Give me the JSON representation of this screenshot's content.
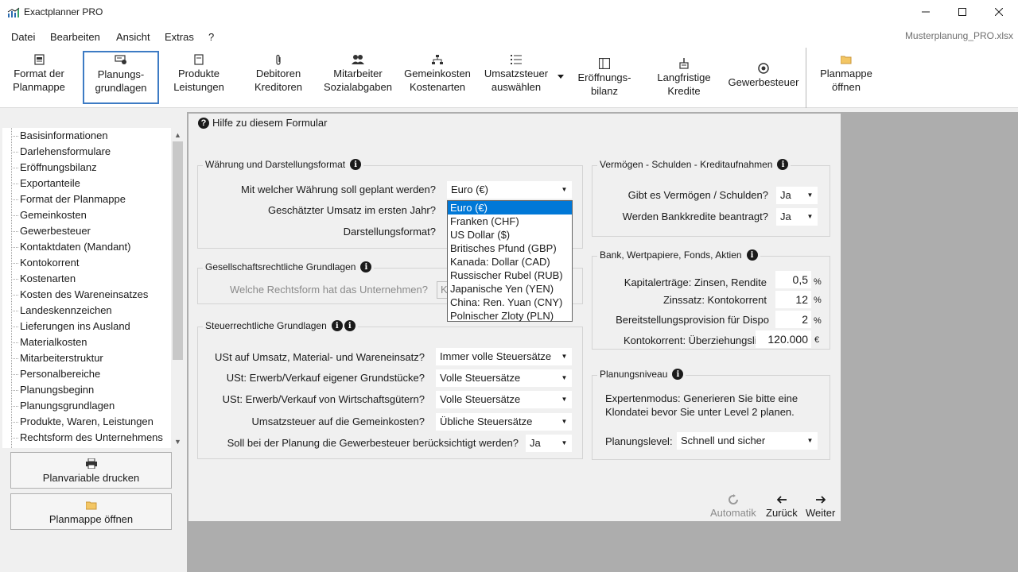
{
  "window": {
    "title": "Exactplanner PRO",
    "filename": "Musterplanung_PRO.xlsx"
  },
  "menu": [
    {
      "label": "Datei"
    },
    {
      "label": "Bearbeiten"
    },
    {
      "label": "Ansicht"
    },
    {
      "label": "Extras"
    },
    {
      "label": "?"
    }
  ],
  "ribbon": {
    "format": {
      "line1": "Format der",
      "line2": "Planmappe",
      "icon": "document-format-icon"
    },
    "planung": {
      "line1": "Planungs-",
      "line2": "grundlagen",
      "icon": "settings-icon"
    },
    "produkte": {
      "line1": "Produkte",
      "line2": "Leistungen",
      "icon": "document-icon"
    },
    "debitoren": {
      "line1": "Debitoren",
      "line2": "Kreditoren",
      "icon": "paperclip-icon"
    },
    "mitarbeiter": {
      "line1": "Mitarbeiter",
      "line2": "Sozialabgaben",
      "icon": "people-icon"
    },
    "gemeinkosten": {
      "line1": "Gemeinkosten",
      "line2": "Kostenarten",
      "icon": "hierarchy-icon"
    },
    "umsatzsteuer": {
      "line1": "Umsatzsteuer",
      "line2": "auswählen",
      "icon": "list-icon"
    },
    "eroeffnung": {
      "line1": "Eröffnungs-",
      "line2": "bilanz",
      "icon": "balance-sheet-icon"
    },
    "kredite": {
      "line1": "Langfristige",
      "line2": "Kredite",
      "icon": "bank-icon"
    },
    "gewerbesteuer": {
      "line1": "Gewerbesteuer",
      "line2": "",
      "icon": "tax-icon"
    },
    "planmappe": {
      "line1": "Planmappe",
      "line2": "öffnen",
      "icon": "folder-icon"
    }
  },
  "tree": {
    "items": [
      "Basisinformationen",
      "Darlehensformulare",
      "Eröffnungsbilanz",
      "Exportanteile",
      "Format der Planmappe",
      "Gemeinkosten",
      "Gewerbesteuer",
      "Kontaktdaten (Mandant)",
      "Kontokorrent",
      "Kostenarten",
      "Kosten des Wareneinsatzes",
      "Landeskennzeichen",
      "Lieferungen ins Ausland",
      "Materialkosten",
      "Mitarbeiterstruktur",
      "Personalbereiche",
      "Planungsbeginn",
      "Planungsgrundlagen",
      "Produkte, Waren, Leistungen",
      "Rechtsform des Unternehmens"
    ]
  },
  "side_buttons": {
    "print": "Planvariable drucken",
    "open": "Planmappe öffnen"
  },
  "form": {
    "help": "Hilfe zu diesem Formular",
    "waehrung": {
      "title": "Währung und Darstellungsformat",
      "q_currency": "Mit welcher Währung soll geplant werden?",
      "currency_value": "Euro (€)",
      "q_umsatz": "Geschätzter Umsatz im ersten Jahr?",
      "q_format": "Darstellungsformat?"
    },
    "gesellschaft": {
      "title": "Gesellschaftsrechtliche Grundlagen",
      "q_rechtsform": "Welche Rechtsform hat das Unternehmen?",
      "rechtsform_value": "K"
    },
    "steuer": {
      "title": "Steuerrechtliche Grundlagen",
      "rows": [
        {
          "label": "USt auf Umsatz, Material- und Wareneinsatz?",
          "value": "Immer volle Steuersätze"
        },
        {
          "label": "USt: Erwerb/Verkauf eigener Grundstücke?",
          "value": "Volle Steuersätze"
        },
        {
          "label": "USt: Erwerb/Verkauf von Wirtschaftsgütern?",
          "value": "Volle Steuersätze"
        },
        {
          "label": "Umsatzsteuer auf die Gemeinkosten?",
          "value": "Übliche Steuersätze"
        }
      ],
      "q_gewerbe": "Soll bei der Planung die Gewerbesteuer berücksichtigt werden?",
      "gewerbe_value": "Ja"
    },
    "vermoegen": {
      "title": "Vermögen - Schulden - Kreditaufnahmen",
      "q_vermoegen": "Gibt es Vermögen / Schulden?",
      "vermoegen_value": "Ja",
      "q_kredite": "Werden Bankkredite beantragt?",
      "kredite_value": "Ja"
    },
    "bank": {
      "title": "Bank, Wertpapiere, Fonds, Aktien",
      "rows": [
        {
          "label": "Kapitalerträge: Zinsen, Rendite",
          "value": "0,5",
          "unit": "%"
        },
        {
          "label": "Zinssatz: Kontokorrent",
          "value": "12",
          "unit": "%"
        },
        {
          "label": "Bereitstellungsprovision für Dispo",
          "value": "2",
          "unit": "%"
        },
        {
          "label": "Kontokorrent: Überziehungslimit",
          "value": "120.000",
          "unit": "€"
        }
      ]
    },
    "niveau": {
      "title": "Planungsniveau",
      "text1": "Expertenmodus: Generieren Sie bitte eine",
      "text2": "Klondatei bevor Sie unter Level 2 planen.",
      "q_level": "Planungslevel:",
      "level_value": "Schnell und sicher"
    }
  },
  "currency_dropdown": {
    "options": [
      "Euro (€)",
      "Franken (CHF)",
      "US Dollar ($)",
      "Britisches Pfund (GBP)",
      "Kanada: Dollar (CAD)",
      "Russischer Rubel (RUB)",
      "Japanische Yen (YEN)",
      "China: Ren. Yuan (CNY)",
      "Polnischer Zloty (PLN)"
    ],
    "selected_index": 0
  },
  "nav": {
    "automatik": "Automatik",
    "zurueck": "Zurück",
    "weiter": "Weiter"
  },
  "colors": {
    "accent": "#0078d7",
    "active_border": "#3d7bc4",
    "gray_area": "#adadad"
  }
}
